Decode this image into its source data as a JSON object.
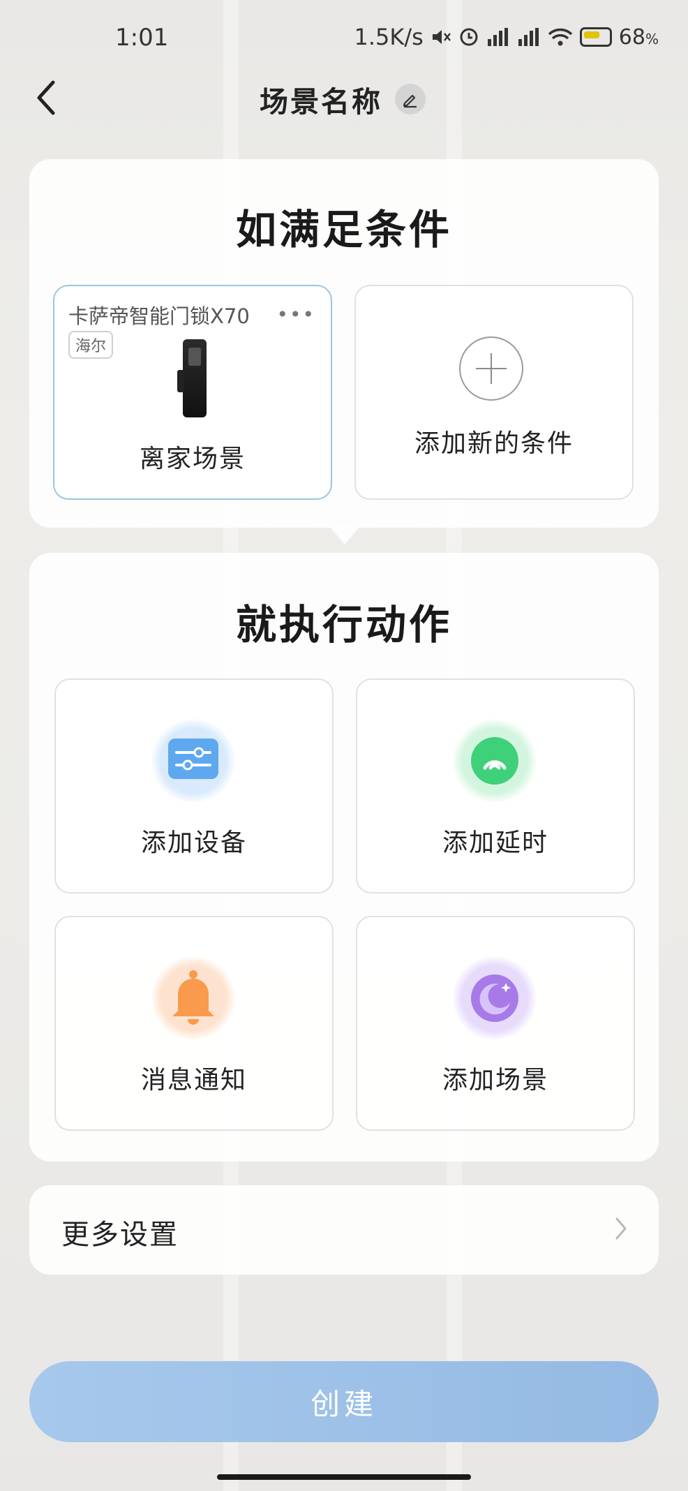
{
  "status_bar": {
    "time": "1:01",
    "network_speed": "1.5K/s",
    "battery_percent": "68",
    "battery_unit": "%"
  },
  "header": {
    "title": "场景名称"
  },
  "conditions": {
    "heading": "如满足条件",
    "device": {
      "name": "卡萨帝智能门锁X70",
      "brand": "海尔",
      "scene": "离家场景"
    },
    "add_label": "添加新的条件"
  },
  "actions": {
    "heading": "就执行动作",
    "items": [
      {
        "label": "添加设备",
        "icon": "sliders-icon",
        "color": "#5ea8f0"
      },
      {
        "label": "添加延时",
        "icon": "timer-icon",
        "color": "#3fd07a"
      },
      {
        "label": "消息通知",
        "icon": "bell-icon",
        "color": "#f99a4c"
      },
      {
        "label": "添加场景",
        "icon": "moon-icon",
        "color": "#a77ae8"
      }
    ]
  },
  "more_settings": {
    "label": "更多设置"
  },
  "create_button": {
    "label": "创建"
  }
}
